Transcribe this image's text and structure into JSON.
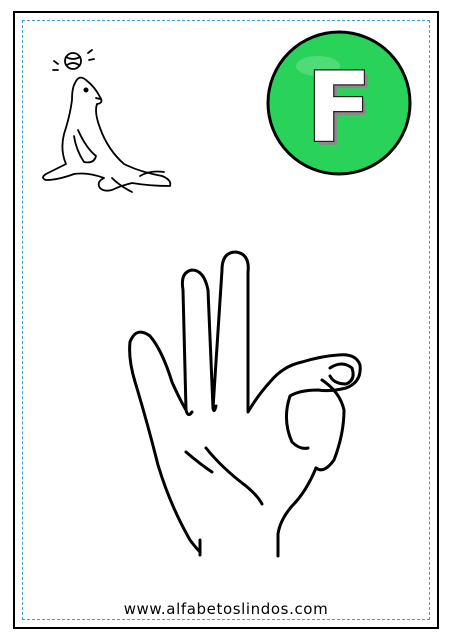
{
  "card": {
    "letter": "F",
    "website": "www.alfabetoslindos.com"
  },
  "colors": {
    "badge_fill": "#29d35a",
    "dashed_border": "#3aa0d8",
    "ink": "#000000"
  },
  "icons": {
    "badge": "letter-f-badge",
    "animal": "seal-with-ball",
    "sign": "hand-sign-f"
  }
}
